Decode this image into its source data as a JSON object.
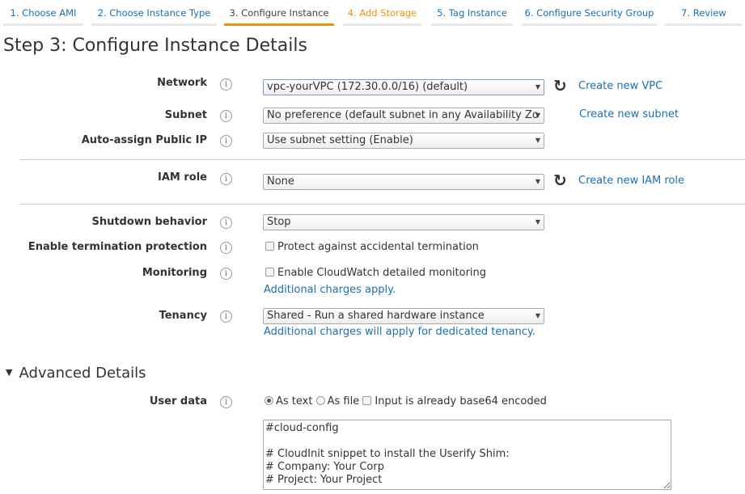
{
  "tabs": [
    {
      "label": "1. Choose AMI",
      "state": "done"
    },
    {
      "label": "2. Choose Instance Type",
      "state": "done"
    },
    {
      "label": "3. Configure Instance",
      "state": "active"
    },
    {
      "label": "4. Add Storage",
      "state": "next"
    },
    {
      "label": "5. Tag Instance",
      "state": "todo"
    },
    {
      "label": "6. Configure Security Group",
      "state": "todo"
    },
    {
      "label": "7. Review",
      "state": "todo"
    }
  ],
  "title": "Step 3: Configure Instance Details",
  "form": {
    "network": {
      "label": "Network",
      "value": "vpc-yourVPC (172.30.0.0/16) (default)",
      "link": "Create new VPC"
    },
    "subnet": {
      "label": "Subnet",
      "value": "No preference (default subnet in any Availability Zo",
      "link": "Create new subnet"
    },
    "public_ip": {
      "label": "Auto-assign Public IP",
      "value": "Use subnet setting (Enable)"
    },
    "iam": {
      "label": "IAM role",
      "value": "None",
      "link": "Create new IAM role"
    },
    "shutdown": {
      "label": "Shutdown behavior",
      "value": "Stop"
    },
    "termination": {
      "label": "Enable termination protection",
      "checkbox": "Protect against accidental termination",
      "checked": false
    },
    "monitoring": {
      "label": "Monitoring",
      "checkbox": "Enable CloudWatch detailed monitoring",
      "checked": false,
      "note": "Additional charges apply."
    },
    "tenancy": {
      "label": "Tenancy",
      "value": "Shared - Run a shared hardware instance",
      "note": "Additional charges will apply for dedicated tenancy."
    }
  },
  "advanced": {
    "title": "Advanced Details",
    "user_data": {
      "label": "User data",
      "as_text": "As text",
      "as_file": "As file",
      "base64": "Input is already base64 encoded",
      "selected": "As text",
      "content": "#cloud-config\n\n# CloudInit snippet to install the Userify Shim:\n# Company: Your Corp\n# Project: Your Project"
    }
  },
  "colors": {
    "accent": "#f0900c",
    "link": "#1a6fb5"
  }
}
